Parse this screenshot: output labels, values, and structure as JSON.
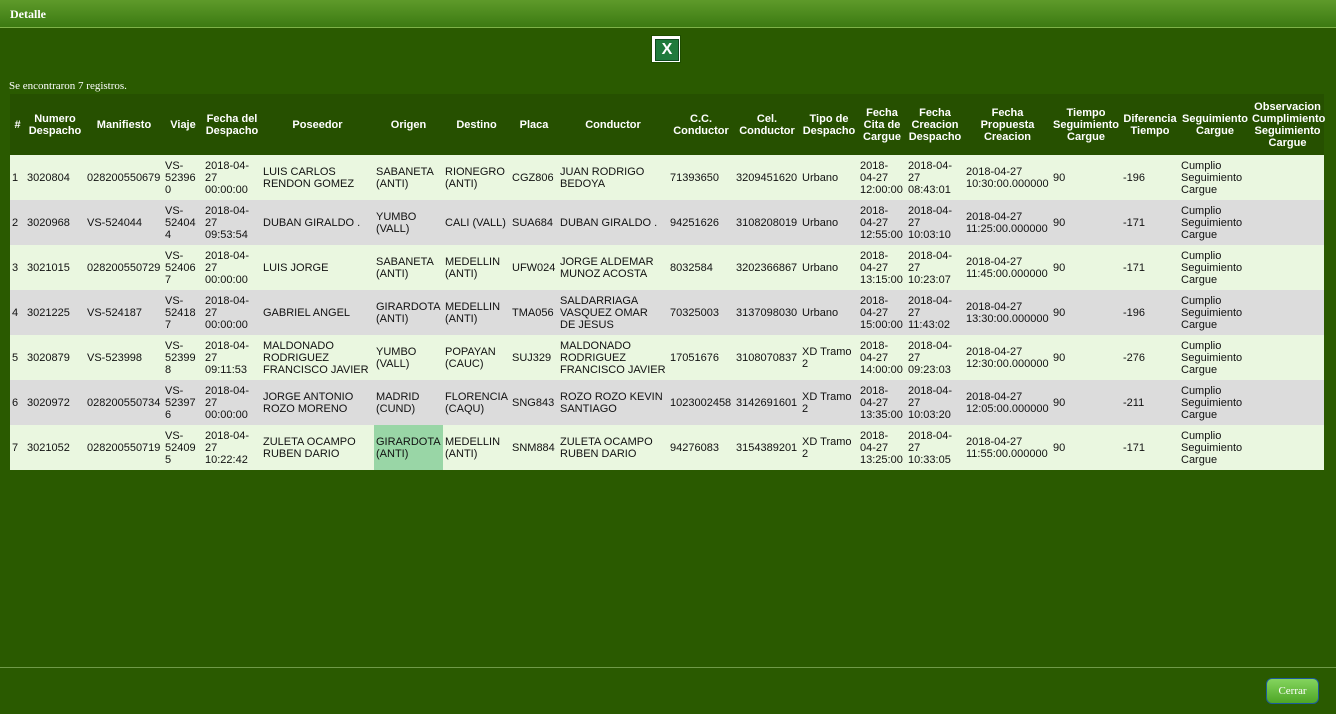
{
  "dialog": {
    "title": "Detalle"
  },
  "toolbar": {
    "export_icon": "excel-icon"
  },
  "summary": {
    "text": "Se encontraron 7 registros."
  },
  "table": {
    "headers": [
      "#",
      "Numero Despacho",
      "Manifiesto",
      "Viaje",
      "Fecha del Despacho",
      "Poseedor",
      "Origen",
      "Destino",
      "Placa",
      "Conductor",
      "C.C. Conductor",
      "Cel. Conductor",
      "Tipo de Despacho",
      "Fecha Cita de Cargue",
      "Fecha Creacion Despacho",
      "Fecha Propuesta Creacion",
      "Tiempo Seguimiento Cargue",
      "Diferencia Tiempo",
      "Seguimiento Cargue",
      "Observacion Cumplimiento Seguimiento Cargue"
    ],
    "rows": [
      [
        "1",
        "3020804",
        "028200550679",
        "VS-523960",
        "2018-04-27 00:00:00",
        "LUIS CARLOS RENDON GOMEZ",
        "SABANETA (ANTI)",
        "RIONEGRO (ANTI)",
        "CGZ806",
        "JUAN RODRIGO BEDOYA",
        "71393650",
        "3209451620",
        "Urbano",
        "2018-04-27 12:00:00",
        "2018-04-27 08:43:01",
        "2018-04-27 10:30:00.000000",
        "90",
        "-196",
        "Cumplio Seguimiento Cargue",
        ""
      ],
      [
        "2",
        "3020968",
        "VS-524044",
        "VS-524044",
        "2018-04-27 09:53:54",
        "DUBAN GIRALDO .",
        "YUMBO (VALL)",
        "CALI (VALL)",
        "SUA684",
        "DUBAN GIRALDO .",
        "94251626",
        "3108208019",
        "Urbano",
        "2018-04-27 12:55:00",
        "2018-04-27 10:03:10",
        "2018-04-27 11:25:00.000000",
        "90",
        "-171",
        "Cumplio Seguimiento Cargue",
        ""
      ],
      [
        "3",
        "3021015",
        "028200550729",
        "VS-524067",
        "2018-04-27 00:00:00",
        "LUIS JORGE",
        "SABANETA (ANTI)",
        "MEDELLIN (ANTI)",
        "UFW024",
        "JORGE ALDEMAR MUNOZ ACOSTA",
        "8032584",
        "3202366867",
        "Urbano",
        "2018-04-27 13:15:00",
        "2018-04-27 10:23:07",
        "2018-04-27 11:45:00.000000",
        "90",
        "-171",
        "Cumplio Seguimiento Cargue",
        ""
      ],
      [
        "4",
        "3021225",
        "VS-524187",
        "VS-524187",
        "2018-04-27 00:00:00",
        "GABRIEL ANGEL",
        "GIRARDOTA (ANTI)",
        "MEDELLIN (ANTI)",
        "TMA056",
        "SALDARRIAGA VASQUEZ OMAR DE JESUS",
        "70325003",
        "3137098030",
        "Urbano",
        "2018-04-27 15:00:00",
        "2018-04-27 11:43:02",
        "2018-04-27 13:30:00.000000",
        "90",
        "-196",
        "Cumplio Seguimiento Cargue",
        ""
      ],
      [
        "5",
        "3020879",
        "VS-523998",
        "VS-523998",
        "2018-04-27 09:11:53",
        "MALDONADO RODRIGUEZ FRANCISCO JAVIER",
        "YUMBO (VALL)",
        "POPAYAN (CAUC)",
        "SUJ329",
        "MALDONADO RODRIGUEZ FRANCISCO JAVIER",
        "17051676",
        "3108070837",
        "XD Tramo 2",
        "2018-04-27 14:00:00",
        "2018-04-27 09:23:03",
        "2018-04-27 12:30:00.000000",
        "90",
        "-276",
        "Cumplio Seguimiento Cargue",
        ""
      ],
      [
        "6",
        "3020972",
        "028200550734",
        "VS-523976",
        "2018-04-27 00:00:00",
        "JORGE ANTONIO ROZO MORENO",
        "MADRID (CUND)",
        "FLORENCIA (CAQU)",
        "SNG843",
        "ROZO ROZO KEVIN SANTIAGO",
        "1023002458",
        "3142691601",
        "XD Tramo 2",
        "2018-04-27 13:35:00",
        "2018-04-27 10:03:20",
        "2018-04-27 12:05:00.000000",
        "90",
        "-211",
        "Cumplio Seguimiento Cargue",
        ""
      ],
      [
        "7",
        "3021052",
        "028200550719",
        "VS-524095",
        "2018-04-27 10:22:42",
        "ZULETA OCAMPO RUBEN DARIO",
        "GIRARDOTA (ANTI)",
        "MEDELLIN (ANTI)",
        "SNM884",
        "ZULETA OCAMPO RUBEN DARIO",
        "94276083",
        "3154389201",
        "XD Tramo 2",
        "2018-04-27 13:25:00",
        "2018-04-27 10:33:05",
        "2018-04-27 11:55:00.000000",
        "90",
        "-171",
        "Cumplio Seguimiento Cargue",
        ""
      ]
    ]
  },
  "footer": {
    "close_label": "Cerrar"
  },
  "colors": {
    "background": "#2a5a00",
    "header": "#265000",
    "row_odd": "#eaf7e0",
    "row_even": "#dcdcdc",
    "link": "#1414c8",
    "highlight": "#99d6a6"
  }
}
